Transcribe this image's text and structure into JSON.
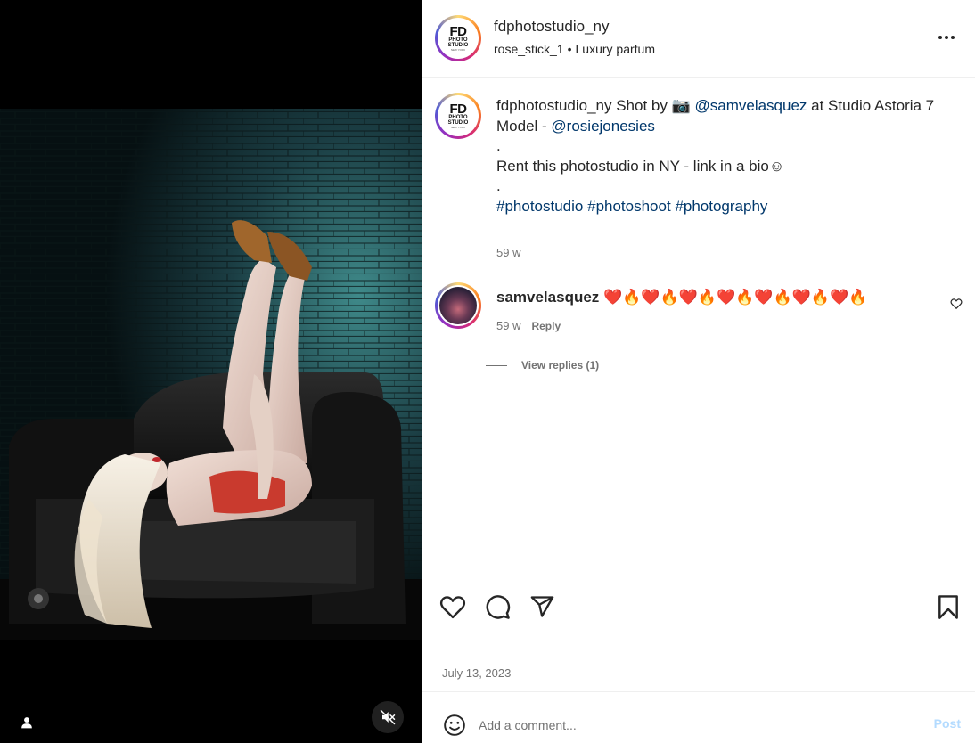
{
  "post": {
    "username": "fdphotostudio_ny",
    "audio": "rose_stick_1",
    "location": "Luxury parfum",
    "date": "July 13, 2023",
    "avatar_logo": {
      "big": "FD",
      "small": "PHOTO STUDIO",
      "tiny": "NEW YORK"
    }
  },
  "caption": {
    "username": "fdphotostudio_ny",
    "text_1": " Shot by 📷  ",
    "mention_1": "@samvelasquez",
    "text_2": " at Studio Astoria 7",
    "line_model_label": "Model - ",
    "mention_2": "@rosiejonesies",
    "dot": ".",
    "line_rent": "Rent this photostudio in NY - link in a bio☺",
    "hashtags": [
      "#photostudio",
      "#photoshoot",
      "#photography"
    ],
    "time": "59 w"
  },
  "comment": {
    "username": "samvelasquez",
    "text": "❤️🔥❤️🔥❤️🔥❤️🔥❤️🔥❤️🔥❤️🔥",
    "time": "59 w",
    "reply_label": "Reply",
    "view_replies": "View replies (1)"
  },
  "comment_box": {
    "placeholder": "Add a comment...",
    "post_label": "Post"
  },
  "icons": {
    "like": "heart-icon",
    "comment": "comment-icon",
    "share": "share-icon",
    "save": "bookmark-icon",
    "more": "more-icon",
    "emoji": "emoji-icon",
    "tags": "user-tag-icon",
    "mute": "audio-muted-icon"
  },
  "colors": {
    "link": "#00376b",
    "muted": "#737373",
    "post_disabled": "#b3dbff"
  }
}
